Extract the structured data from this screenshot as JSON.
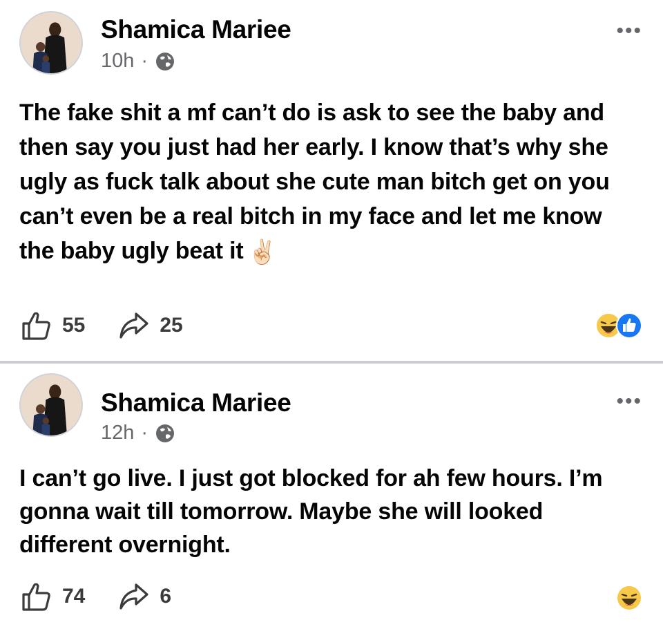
{
  "posts": [
    {
      "author": "Shamica Mariee",
      "time": "10h",
      "dot": "·",
      "text": "The fake shit a mf can’t do is ask to see the baby and then say you just had her early. I know that’s why she ugly as fuck talk about she cute man bitch get on you can’t even be a real bitch in my face and let me know the baby ugly beat it",
      "emoji": "✌🏻",
      "likes": "55",
      "shares": "25",
      "reactions": [
        "laugh-icon",
        "like-icon"
      ]
    },
    {
      "author": "Shamica Mariee",
      "time": "12h",
      "dot": "·",
      "text": "I can’t go live. I just got blocked for ah few hours. I’m gonna wait till tomorrow. Maybe she will looked different overnight.",
      "likes": "74",
      "shares": "6",
      "reactions": [
        "laugh-icon"
      ]
    }
  ],
  "more_label": "•••",
  "colors": {
    "secondary_text": "#65676b",
    "like_blue": "#1877f2",
    "laugh_yellow": "#f7c94a",
    "separator": "#c9ccd1"
  }
}
